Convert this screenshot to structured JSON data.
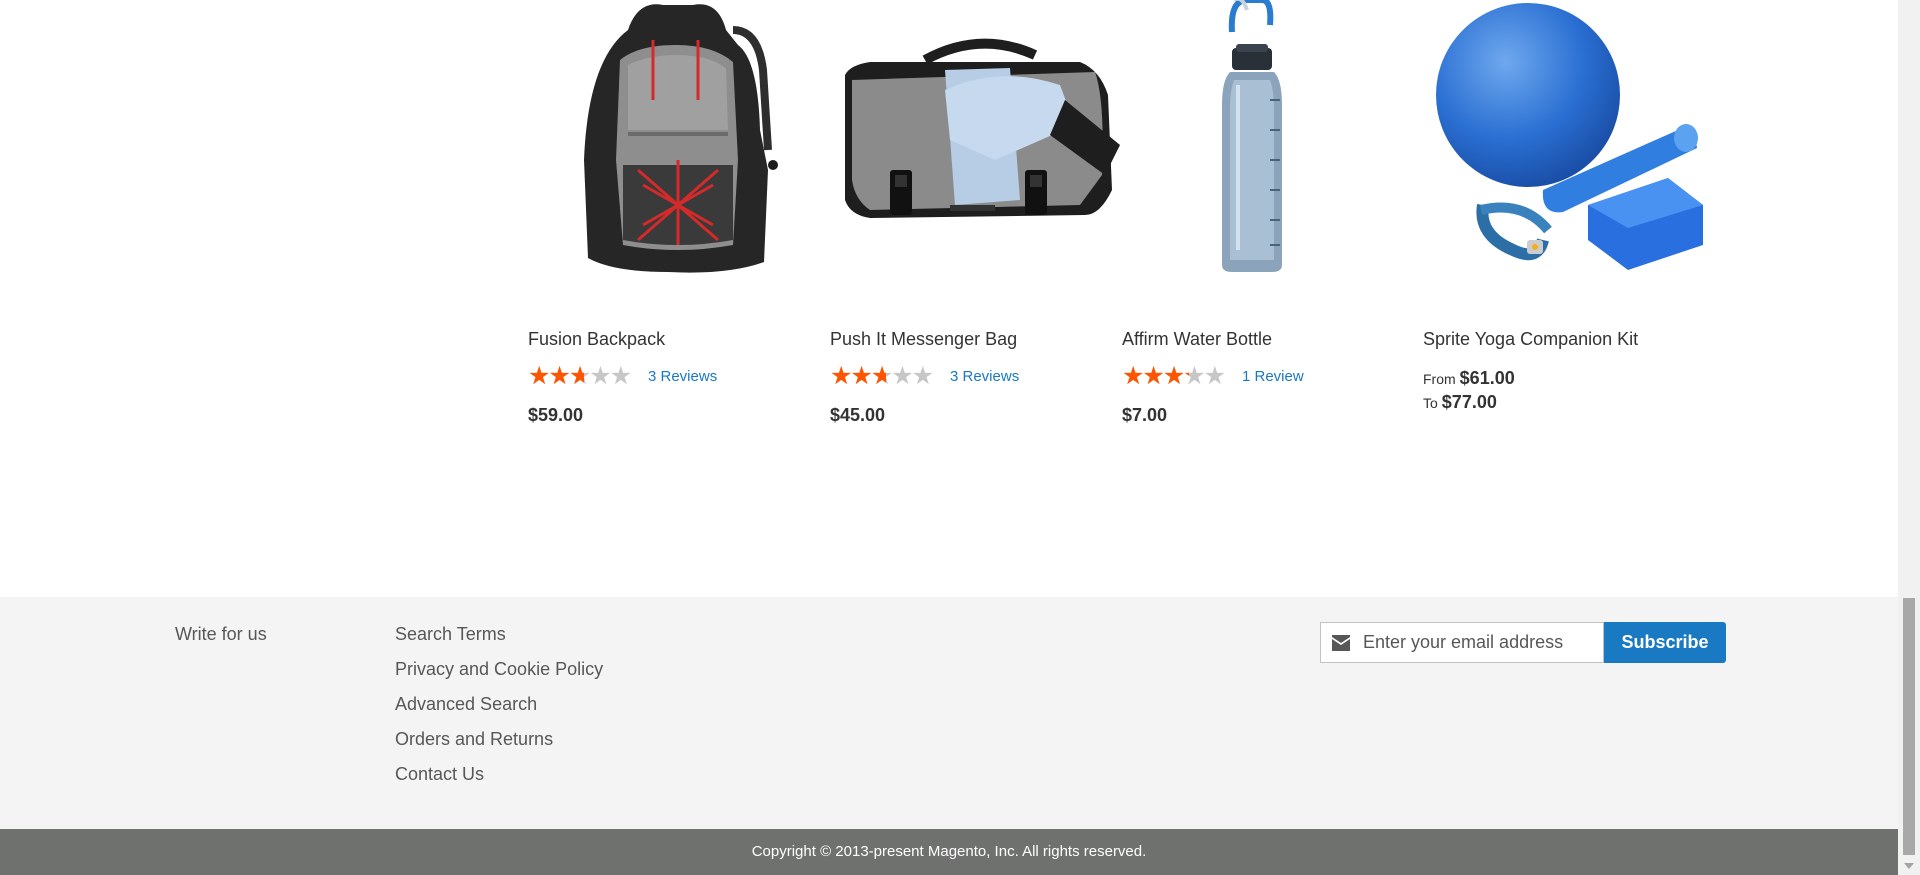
{
  "products": [
    {
      "name": "Fusion Backpack",
      "rating": 2.5,
      "rating_max": 5,
      "reviews_label": "3 Reviews",
      "price": "$59.00",
      "image_icon": "backpack-image"
    },
    {
      "name": "Push It Messenger Bag",
      "rating": 2.5,
      "rating_max": 5,
      "reviews_label": "3 Reviews",
      "price": "$45.00",
      "image_icon": "messenger-bag-image"
    },
    {
      "name": "Affirm Water Bottle",
      "rating": 3,
      "rating_max": 5,
      "reviews_label": "1 Review",
      "price": "$7.00",
      "image_icon": "water-bottle-image"
    },
    {
      "name": "Sprite Yoga Companion Kit",
      "price_from_label": "From",
      "price_from": "$61.00",
      "price_to_label": "To",
      "price_to": "$77.00",
      "image_icon": "yoga-kit-image"
    }
  ],
  "footer": {
    "col1_link": "Write for us",
    "links": [
      "Search Terms",
      "Privacy and Cookie Policy",
      "Advanced Search",
      "Orders and Returns",
      "Contact Us"
    ],
    "newsletter": {
      "placeholder": "Enter your email address",
      "button_label": "Subscribe",
      "icon": "envelope-icon"
    },
    "copyright": "Copyright © 2013-present Magento, Inc. All rights reserved."
  },
  "colors": {
    "star_filled": "#ff5501",
    "star_empty": "#c7c7c7",
    "link": "#1979c3",
    "footer_bg": "#f4f4f4",
    "copyright_bg": "#6e716e",
    "button_bg": "#1979c3"
  }
}
